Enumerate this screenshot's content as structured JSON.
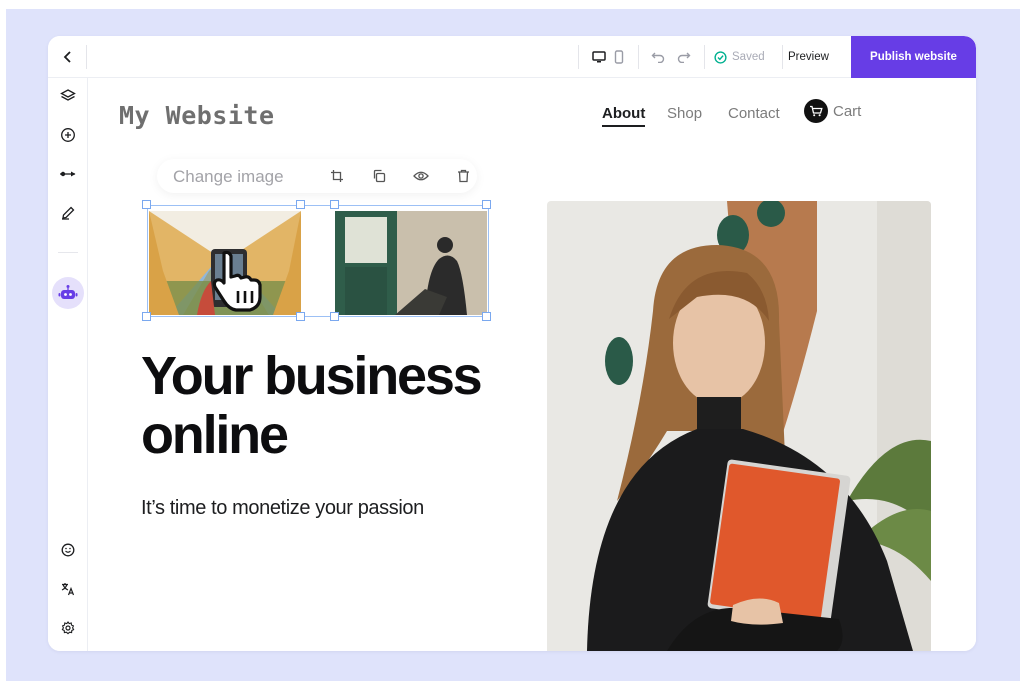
{
  "topbar": {
    "back_icon": "chevron-left-icon",
    "device_icons": [
      "desktop-icon",
      "mobile-icon"
    ],
    "history_icons": [
      "undo-icon",
      "redo-icon"
    ],
    "saved_label": "Saved",
    "preview_label": "Preview",
    "publish_label": "Publish website",
    "accent_color": "#673de6"
  },
  "sidebar": {
    "items": [
      {
        "icon": "layers-icon"
      },
      {
        "icon": "add-icon"
      },
      {
        "icon": "pen-tool-icon"
      },
      {
        "icon": "brush-icon"
      },
      {
        "icon": "ai-robot-icon"
      },
      {
        "icon": "smiley-icon"
      },
      {
        "icon": "translate-icon"
      },
      {
        "icon": "settings-icon"
      }
    ]
  },
  "site": {
    "logo": "My Website",
    "nav": [
      "About",
      "Shop",
      "Contact"
    ],
    "active_nav": "About",
    "cart_label": "Cart"
  },
  "image_toolbar": {
    "change_label": "Change image",
    "tools": [
      "crop-icon",
      "duplicate-icon",
      "eye-icon",
      "trash-icon"
    ]
  },
  "hero": {
    "headline_line1": "Your business",
    "headline_line2": "online",
    "subtitle": "It’s time to monetize your passion"
  }
}
